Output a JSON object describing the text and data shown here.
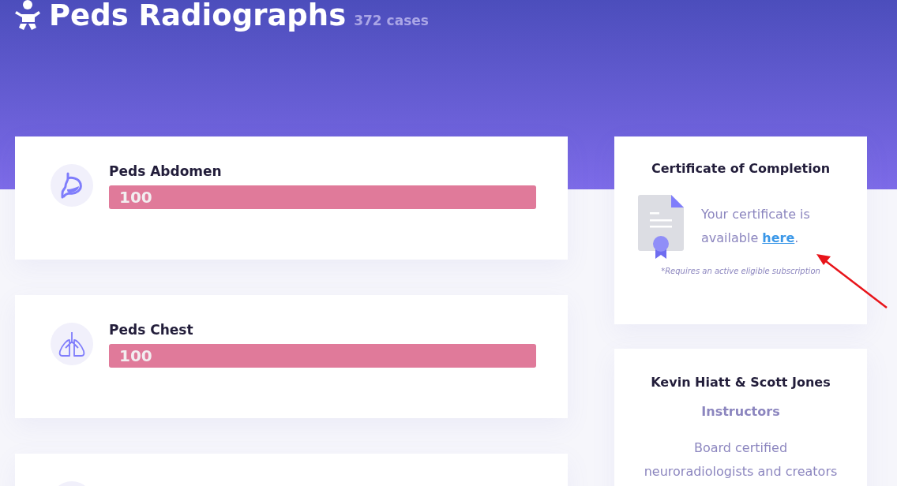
{
  "header": {
    "title": "Peds Radiographs",
    "count": "372 cases"
  },
  "modules": [
    {
      "kind": "stomach",
      "name": "Peds Abdomen",
      "level": 1,
      "score": "100"
    },
    {
      "kind": "lungs",
      "name": "Peds Chest",
      "level": 1,
      "score": "100"
    },
    {
      "kind": "blank"
    }
  ],
  "certificate": {
    "title": "Certificate of Completion",
    "text": "Your certificate is available",
    "link": "here",
    "after": ".",
    "note": "*Requires an active eligible subscription"
  },
  "instructors": {
    "names": "Kevin Hiatt & Scott Jones",
    "role": "Instructors",
    "bio": "Board certified neuroradiologists and creators"
  }
}
